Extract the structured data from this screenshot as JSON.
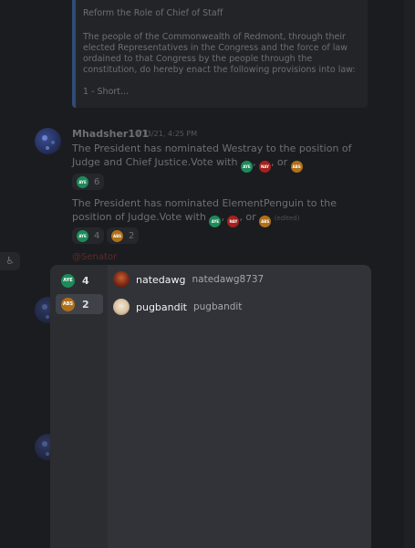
{
  "embed": {
    "title": "Reform the Role of Chief of Staff",
    "body": "The people of the Commonwealth of Redmont, through their elected Representatives in the Congress and the force of law ordained to that Congress by the people through the constitution, do hereby enact the following provisions into law:",
    "footer": "1 - Short..."
  },
  "message": {
    "author": "Mhadsher101",
    "timestamp": "4/13/21, 4:25 PM",
    "text1_a": "The President has nominated Westray to the position of Judge and Chief Justice.Vote with",
    "text1_b": ",",
    "text1_c": ", or",
    "text2_a": "The President has nominated ElementPenguin to the position of Judge.Vote with",
    "text2_b": ",",
    "text2_c": ", or",
    "edited": "(edited)",
    "mention": "@Senator",
    "reaction1_count": "6",
    "reaction2_aye_count": "4",
    "reaction2_abs_count": "2"
  },
  "emoji_labels": {
    "aye": "AYE",
    "nay": "NAY",
    "abs": "ABS"
  },
  "popout": {
    "reactions": [
      {
        "emoji": "AYE",
        "count": "4",
        "selected": false
      },
      {
        "emoji": "ABS",
        "count": "2",
        "selected": true
      }
    ],
    "users": [
      {
        "name": "natedawg",
        "tag": "natedawg8737"
      },
      {
        "name": "pugbandit",
        "tag": "pugbandit"
      }
    ]
  },
  "colors": {
    "aye": "#1d8a5a",
    "nay": "#a5211f",
    "abs": "#b0701a",
    "popout_bg": "#313338"
  },
  "icons": {
    "side_button": "accessibility-icon"
  }
}
